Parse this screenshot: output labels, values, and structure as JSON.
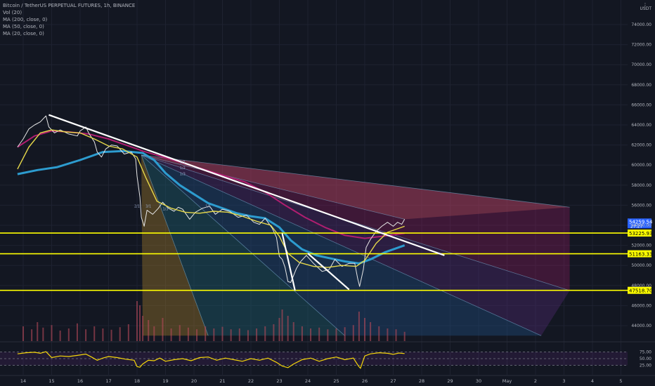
{
  "header": {
    "symbol_line": "Bitcoin / TetherUS PERPETUAL FUTURES, 1h, BINANCE",
    "indicators": [
      "Vol (20)",
      "MA (200, close, 0)",
      "MA (50, close, 0)",
      "MA (20, close, 0)"
    ],
    "currency": "USDT",
    "menu_icon": "dots-icon"
  },
  "colors": {
    "background": "#131722",
    "price": "#e6e6e6",
    "ma20": "#e6d84a",
    "ma50": "#2d9ccf",
    "ma200": "#b01e70",
    "trendline": "#ffffff",
    "level": "#ffff00",
    "rsi": "#f5d60a"
  },
  "chart_data": {
    "type": "line",
    "x_ticks": [
      "14",
      "15",
      "16",
      "17",
      "18",
      "19",
      "20",
      "21",
      "22",
      "23",
      "24",
      "25",
      "26",
      "27",
      "28",
      "29",
      "30",
      "May",
      "2",
      "3",
      "4",
      "5"
    ],
    "y_ticks": [
      44000,
      46000,
      48000,
      50000,
      52000,
      54000,
      56000,
      58000,
      60000,
      62000,
      64000,
      66000,
      68000,
      70000,
      72000,
      74000
    ],
    "ylim": [
      42800,
      76200
    ],
    "price_series": [
      [
        13.8,
        61800
      ],
      [
        14.0,
        62600
      ],
      [
        14.2,
        63600
      ],
      [
        14.4,
        64000
      ],
      [
        14.6,
        64300
      ],
      [
        14.8,
        64900
      ],
      [
        14.9,
        63800
      ],
      [
        15.1,
        63200
      ],
      [
        15.3,
        63500
      ],
      [
        15.6,
        63100
      ],
      [
        15.9,
        62900
      ],
      [
        16.0,
        63400
      ],
      [
        16.2,
        63800
      ],
      [
        16.3,
        63200
      ],
      [
        16.5,
        62300
      ],
      [
        16.6,
        61300
      ],
      [
        16.75,
        60800
      ],
      [
        16.9,
        61600
      ],
      [
        17.1,
        62000
      ],
      [
        17.3,
        61900
      ],
      [
        17.55,
        61100
      ],
      [
        17.8,
        61300
      ],
      [
        17.95,
        60600
      ],
      [
        18.0,
        58900
      ],
      [
        18.1,
        56800
      ],
      [
        18.15,
        54800
      ],
      [
        18.25,
        53900
      ],
      [
        18.35,
        55500
      ],
      [
        18.55,
        55100
      ],
      [
        18.75,
        55700
      ],
      [
        18.9,
        56300
      ],
      [
        19.1,
        55700
      ],
      [
        19.3,
        55400
      ],
      [
        19.45,
        55800
      ],
      [
        19.6,
        55600
      ],
      [
        19.85,
        54600
      ],
      [
        20.05,
        55300
      ],
      [
        20.3,
        55700
      ],
      [
        20.55,
        55900
      ],
      [
        20.75,
        55100
      ],
      [
        21.0,
        55600
      ],
      [
        21.25,
        55400
      ],
      [
        21.55,
        54800
      ],
      [
        21.85,
        55000
      ],
      [
        22.1,
        54300
      ],
      [
        22.3,
        54100
      ],
      [
        22.5,
        54700
      ],
      [
        22.75,
        53700
      ],
      [
        22.9,
        52800
      ],
      [
        23.0,
        50900
      ],
      [
        23.1,
        50600
      ],
      [
        23.2,
        49800
      ],
      [
        23.3,
        48400
      ],
      [
        23.4,
        48300
      ],
      [
        23.6,
        49700
      ],
      [
        23.75,
        50400
      ],
      [
        23.95,
        51000
      ],
      [
        24.2,
        50200
      ],
      [
        24.5,
        49400
      ],
      [
        24.75,
        49600
      ],
      [
        24.95,
        50600
      ],
      [
        25.2,
        49900
      ],
      [
        25.45,
        50200
      ],
      [
        25.65,
        50200
      ],
      [
        25.75,
        48700
      ],
      [
        25.82,
        47900
      ],
      [
        25.95,
        49600
      ],
      [
        26.05,
        51800
      ],
      [
        26.2,
        52600
      ],
      [
        26.4,
        53400
      ],
      [
        26.6,
        53900
      ],
      [
        26.8,
        54300
      ],
      [
        27.0,
        53900
      ],
      [
        27.15,
        54300
      ],
      [
        27.3,
        54100
      ],
      [
        27.4,
        54600
      ]
    ],
    "ma20_series": [
      [
        13.8,
        59600
      ],
      [
        14.2,
        61800
      ],
      [
        14.6,
        63200
      ],
      [
        15.0,
        63500
      ],
      [
        15.5,
        63300
      ],
      [
        16.0,
        63200
      ],
      [
        16.5,
        62600
      ],
      [
        17.0,
        61900
      ],
      [
        17.5,
        61600
      ],
      [
        18.0,
        60800
      ],
      [
        18.3,
        58800
      ],
      [
        18.7,
        56400
      ],
      [
        19.2,
        55700
      ],
      [
        19.7,
        55300
      ],
      [
        20.2,
        55200
      ],
      [
        20.7,
        55400
      ],
      [
        21.2,
        55300
      ],
      [
        21.7,
        54900
      ],
      [
        22.2,
        54400
      ],
      [
        22.7,
        54000
      ],
      [
        23.0,
        52900
      ],
      [
        23.3,
        51200
      ],
      [
        23.7,
        50300
      ],
      [
        24.2,
        49900
      ],
      [
        24.7,
        49800
      ],
      [
        25.2,
        50000
      ],
      [
        25.7,
        49900
      ],
      [
        26.0,
        50500
      ],
      [
        26.4,
        52200
      ],
      [
        26.8,
        53300
      ],
      [
        27.4,
        53900
      ]
    ],
    "ma50_series": [
      [
        13.8,
        59100
      ],
      [
        14.5,
        59500
      ],
      [
        15.2,
        59800
      ],
      [
        16.0,
        60500
      ],
      [
        16.8,
        61300
      ],
      [
        17.5,
        61400
      ],
      [
        18.2,
        61200
      ],
      [
        18.6,
        60500
      ],
      [
        19.0,
        59200
      ],
      [
        19.5,
        58000
      ],
      [
        20.0,
        57100
      ],
      [
        20.5,
        56200
      ],
      [
        21.0,
        55700
      ],
      [
        21.5,
        55200
      ],
      [
        22.0,
        54900
      ],
      [
        22.5,
        54700
      ],
      [
        23.0,
        53800
      ],
      [
        23.4,
        52500
      ],
      [
        23.8,
        51600
      ],
      [
        24.3,
        51000
      ],
      [
        24.8,
        50700
      ],
      [
        25.3,
        50400
      ],
      [
        25.8,
        50200
      ],
      [
        26.2,
        50600
      ],
      [
        26.7,
        51300
      ],
      [
        27.4,
        52000
      ]
    ],
    "ma200_series": [
      [
        13.8,
        61800
      ],
      [
        14.4,
        62900
      ],
      [
        15.0,
        63400
      ],
      [
        15.6,
        63300
      ],
      [
        16.3,
        63100
      ],
      [
        17.0,
        62600
      ],
      [
        17.6,
        62000
      ],
      [
        18.2,
        61400
      ],
      [
        18.8,
        60900
      ],
      [
        19.5,
        60300
      ],
      [
        20.2,
        59700
      ],
      [
        21.0,
        59000
      ],
      [
        21.8,
        58300
      ],
      [
        22.5,
        57300
      ],
      [
        23.2,
        56000
      ],
      [
        23.9,
        54800
      ],
      [
        24.6,
        53800
      ],
      [
        25.3,
        53000
      ],
      [
        26.0,
        52700
      ],
      [
        26.6,
        52900
      ],
      [
        27.4,
        53200
      ]
    ],
    "trendlines": [
      {
        "from": [
          14.9,
          65000
        ],
        "to": [
          28.8,
          51000
        ]
      },
      {
        "from": [
          23.1,
          53200
        ],
        "to": [
          23.55,
          47500
        ]
      },
      {
        "from": [
          24.0,
          51200
        ],
        "to": [
          25.45,
          47600
        ]
      }
    ],
    "horizontal_levels": [
      {
        "value": 53225.93,
        "label": "53225.93"
      },
      {
        "value": 51163.33,
        "label": "51163.33"
      },
      {
        "value": 47518.7,
        "label": "47518.70"
      }
    ],
    "last_price": {
      "value": 54259.54,
      "label": "54259.54",
      "sub": "27:27"
    },
    "fan_labels": [
      "1/1",
      "1/2",
      "1/3",
      "2/1",
      "3/1",
      "1/1",
      "1/3"
    ],
    "rsi": {
      "levels": [
        75.0,
        50.0,
        25.0
      ],
      "tick_labels": [
        "75.00",
        "50.00",
        "25.00"
      ],
      "series": [
        [
          13.8,
          68
        ],
        [
          14.1,
          72
        ],
        [
          14.4,
          74
        ],
        [
          14.6,
          70
        ],
        [
          14.8,
          76
        ],
        [
          15.0,
          54
        ],
        [
          15.3,
          60
        ],
        [
          15.6,
          58
        ],
        [
          15.9,
          62
        ],
        [
          16.2,
          67
        ],
        [
          16.4,
          56
        ],
        [
          16.6,
          44
        ],
        [
          16.8,
          52
        ],
        [
          17.0,
          58
        ],
        [
          17.3,
          54
        ],
        [
          17.6,
          48
        ],
        [
          17.9,
          44
        ],
        [
          18.0,
          20
        ],
        [
          18.1,
          18
        ],
        [
          18.2,
          30
        ],
        [
          18.4,
          44
        ],
        [
          18.6,
          42
        ],
        [
          18.8,
          52
        ],
        [
          19.0,
          40
        ],
        [
          19.3,
          46
        ],
        [
          19.6,
          50
        ],
        [
          19.9,
          42
        ],
        [
          20.2,
          54
        ],
        [
          20.5,
          56
        ],
        [
          20.8,
          44
        ],
        [
          21.1,
          52
        ],
        [
          21.4,
          46
        ],
        [
          21.7,
          40
        ],
        [
          22.0,
          50
        ],
        [
          22.3,
          44
        ],
        [
          22.6,
          52
        ],
        [
          22.9,
          36
        ],
        [
          23.1,
          22
        ],
        [
          23.3,
          16
        ],
        [
          23.5,
          30
        ],
        [
          23.8,
          46
        ],
        [
          24.1,
          52
        ],
        [
          24.4,
          40
        ],
        [
          24.7,
          50
        ],
        [
          25.0,
          56
        ],
        [
          25.3,
          46
        ],
        [
          25.6,
          52
        ],
        [
          25.78,
          22
        ],
        [
          25.85,
          14
        ],
        [
          26.0,
          60
        ],
        [
          26.2,
          68
        ],
        [
          26.5,
          72
        ],
        [
          26.8,
          70
        ],
        [
          27.0,
          66
        ],
        [
          27.2,
          71
        ],
        [
          27.4,
          69
        ]
      ]
    },
    "volume": [
      [
        14.0,
        0.35
      ],
      [
        14.3,
        0.28
      ],
      [
        14.5,
        0.45
      ],
      [
        14.7,
        0.32
      ],
      [
        15.0,
        0.38
      ],
      [
        15.3,
        0.25
      ],
      [
        15.6,
        0.3
      ],
      [
        15.9,
        0.42
      ],
      [
        16.2,
        0.28
      ],
      [
        16.5,
        0.35
      ],
      [
        16.8,
        0.3
      ],
      [
        17.1,
        0.27
      ],
      [
        17.4,
        0.33
      ],
      [
        17.7,
        0.4
      ],
      [
        18.0,
        0.95
      ],
      [
        18.1,
        0.85
      ],
      [
        18.2,
        0.6
      ],
      [
        18.4,
        0.5
      ],
      [
        18.6,
        0.35
      ],
      [
        18.9,
        0.55
      ],
      [
        19.2,
        0.3
      ],
      [
        19.5,
        0.38
      ],
      [
        19.8,
        0.32
      ],
      [
        20.1,
        0.28
      ],
      [
        20.4,
        0.35
      ],
      [
        20.7,
        0.3
      ],
      [
        21.0,
        0.34
      ],
      [
        21.3,
        0.28
      ],
      [
        21.6,
        0.3
      ],
      [
        21.9,
        0.26
      ],
      [
        22.2,
        0.3
      ],
      [
        22.5,
        0.35
      ],
      [
        22.8,
        0.4
      ],
      [
        23.0,
        0.55
      ],
      [
        23.1,
        0.75
      ],
      [
        23.3,
        0.6
      ],
      [
        23.5,
        0.45
      ],
      [
        23.8,
        0.35
      ],
      [
        24.1,
        0.3
      ],
      [
        24.4,
        0.32
      ],
      [
        24.7,
        0.28
      ],
      [
        25.0,
        0.3
      ],
      [
        25.3,
        0.33
      ],
      [
        25.6,
        0.38
      ],
      [
        25.8,
        0.7
      ],
      [
        26.0,
        0.55
      ],
      [
        26.2,
        0.45
      ],
      [
        26.5,
        0.35
      ],
      [
        26.8,
        0.3
      ],
      [
        27.1,
        0.28
      ],
      [
        27.4,
        0.22
      ]
    ]
  }
}
